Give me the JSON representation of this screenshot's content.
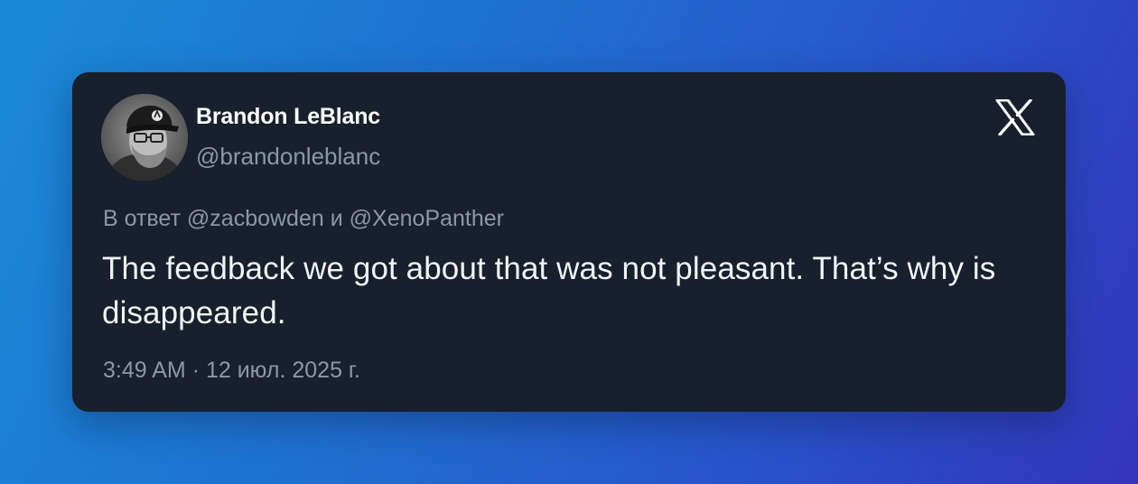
{
  "tweet": {
    "author": {
      "display_name": "Brandon LeBlanc",
      "handle": "@brandonleblanc",
      "avatar_icon": "user-avatar-photo"
    },
    "platform_icon": "x-logo-icon",
    "reply_prefix": "В ответ",
    "reply_mentions": [
      "@zacbowden",
      "@XenoPanther"
    ],
    "reply_conjunction": "и",
    "text": "The feedback we got about that was not pleasant. That’s why is disappeared.",
    "time": "3:49 AM",
    "separator": "·",
    "date": "12 июл. 2025 г."
  },
  "colors": {
    "card_background": "#18202d",
    "primary_text": "#f2f4f6",
    "secondary_text": "#8b98a5"
  }
}
